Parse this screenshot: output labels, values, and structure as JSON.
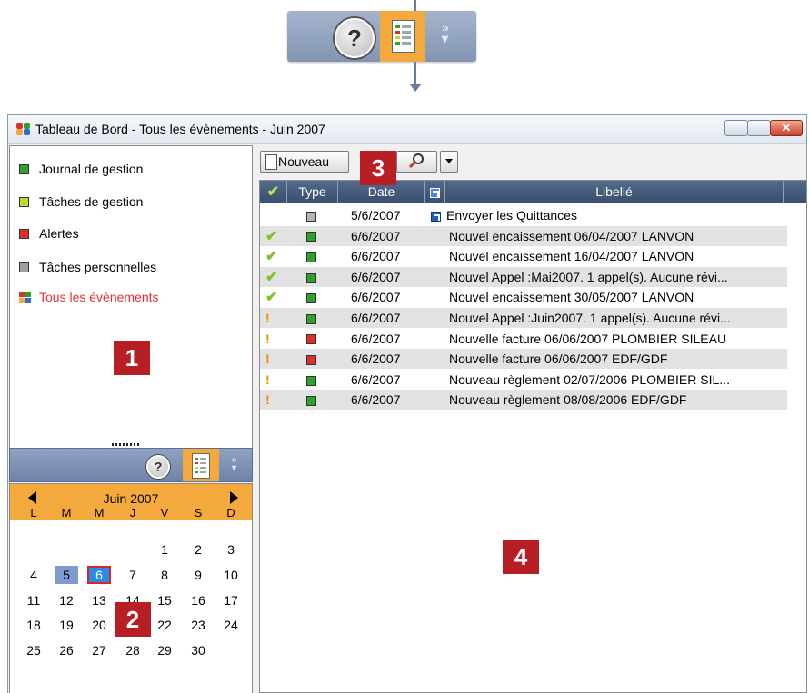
{
  "window": {
    "title": "Tableau de Bord - Tous les évènements - Juin 2007"
  },
  "top_toolbar": {
    "help_icon": "help-icon",
    "dashboard_icon": "dashboard-icon",
    "more_icon": "chevron-double-right-icon"
  },
  "nav": {
    "items": [
      {
        "label": "Journal de gestion",
        "color": "#2aa32a"
      },
      {
        "label": "Tâches de gestion",
        "color": "#c4d833"
      },
      {
        "label": "Alertes",
        "color": "#e12c2c"
      },
      {
        "label": "Tâches personnelles",
        "color": "#a0a0a0"
      },
      {
        "label": "Tous les évènements",
        "color": "#e8303a"
      }
    ]
  },
  "calendar": {
    "month": "Juin 2007",
    "weekdays": [
      "L",
      "M",
      "M",
      "J",
      "V",
      "S",
      "D"
    ],
    "weeks": [
      [
        "",
        "",
        "",
        "",
        "1",
        "2",
        "3"
      ],
      [
        "4",
        "5",
        "6",
        "7",
        "8",
        "9",
        "10"
      ],
      [
        "11",
        "12",
        "13",
        "14",
        "15",
        "16",
        "17"
      ],
      [
        "18",
        "19",
        "20",
        "21",
        "22",
        "23",
        "24"
      ],
      [
        "25",
        "26",
        "27",
        "28",
        "29",
        "30",
        ""
      ]
    ],
    "selected_day": "5",
    "today": "6"
  },
  "toolbar": {
    "new_label": "Nouveau"
  },
  "grid": {
    "headers": {
      "status": "✔",
      "type": "Type",
      "date": "Date",
      "label": "Libellé"
    },
    "rows": [
      {
        "status": "",
        "type_color": "#b4b4b4",
        "date": "5/6/2007",
        "link": true,
        "label": "Envoyer les Quittances"
      },
      {
        "status": "done",
        "type_color": "#2aa32a",
        "date": "6/6/2007",
        "link": false,
        "label": "Nouvel encaissement 06/04/2007 LANVON"
      },
      {
        "status": "done",
        "type_color": "#2aa32a",
        "date": "6/6/2007",
        "link": false,
        "label": "Nouvel encaissement 16/04/2007 LANVON"
      },
      {
        "status": "done",
        "type_color": "#2aa32a",
        "date": "6/6/2007",
        "link": false,
        "label": "Nouvel Appel :Mai2007. 1 appel(s). Aucune révi..."
      },
      {
        "status": "done",
        "type_color": "#2aa32a",
        "date": "6/6/2007",
        "link": false,
        "label": "Nouvel encaissement 30/05/2007 LANVON"
      },
      {
        "status": "pending",
        "type_color": "#2aa32a",
        "date": "6/6/2007",
        "link": false,
        "label": "Nouvel Appel :Juin2007. 1 appel(s). Aucune révi..."
      },
      {
        "status": "pending",
        "type_color": "#e12c2c",
        "date": "6/6/2007",
        "link": false,
        "label": "Nouvelle facture 06/06/2007 PLOMBIER SILEAU"
      },
      {
        "status": "pending",
        "type_color": "#e12c2c",
        "date": "6/6/2007",
        "link": false,
        "label": "Nouvelle facture 06/06/2007 EDF/GDF"
      },
      {
        "status": "pending",
        "type_color": "#2aa32a",
        "date": "6/6/2007",
        "link": false,
        "label": "Nouveau règlement 02/07/2006 PLOMBIER SIL..."
      },
      {
        "status": "pending",
        "type_color": "#2aa32a",
        "date": "6/6/2007",
        "link": false,
        "label": "Nouveau règlement 08/08/2006 EDF/GDF"
      }
    ]
  },
  "callouts": [
    "1",
    "2",
    "3",
    "4"
  ]
}
